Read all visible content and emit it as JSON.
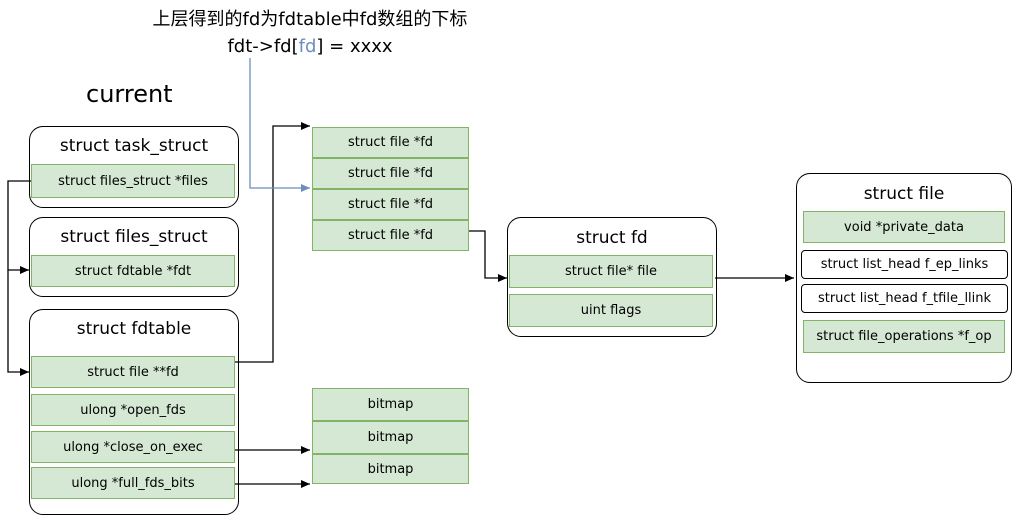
{
  "header": {
    "line1": "上层得到的fd为fdtable中fd数组的下标",
    "line2_prefix": "fdt->fd[",
    "line2_highlight": "fd",
    "line2_suffix": "] = xxxx",
    "highlight_color": "#6c8ebf"
  },
  "current_label": "current",
  "task_struct": {
    "title": "struct task_struct",
    "field": "struct files_struct *files"
  },
  "files_struct": {
    "title": "struct files_struct",
    "field": "struct fdtable *fdt"
  },
  "fdtable": {
    "title": "struct fdtable",
    "fields": [
      "struct file **fd",
      "ulong *open_fds",
      "ulong *close_on_exec",
      "ulong *full_fds_bits"
    ]
  },
  "fd_array": [
    "struct file *fd",
    "struct file *fd",
    "struct file *fd",
    "struct file *fd"
  ],
  "bitmaps": [
    "bitmap",
    "bitmap",
    "bitmap"
  ],
  "struct_fd": {
    "title": "struct fd",
    "fields": [
      "struct file* file",
      "uint flags"
    ]
  },
  "struct_file": {
    "title": "struct file",
    "fields": [
      "void *private_data",
      "struct list_head f_ep_links",
      "struct list_head f_tfile_llink",
      "struct file_operations *f_op"
    ]
  },
  "colors": {
    "cell_fill": "#d5e8d4",
    "cell_border": "#82b366",
    "arrow_blue": "#6c8ebf"
  }
}
